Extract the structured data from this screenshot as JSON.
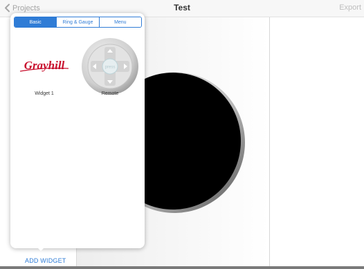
{
  "navbar": {
    "back_label": "Projects",
    "title": "Test",
    "export_label": "Export"
  },
  "popover": {
    "tabs": [
      {
        "label": "Basic",
        "active": true
      },
      {
        "label": "Ring & Gauge",
        "active": false
      },
      {
        "label": "Menu",
        "active": false
      }
    ],
    "widgets": [
      {
        "label": "Widget 1",
        "logo_text": "Grayhill",
        "icon": "grayhill-logo-icon"
      },
      {
        "label": "Remote",
        "center_text": "press",
        "icon": "remote-dpad-icon"
      }
    ]
  },
  "bottom": {
    "add_widget_label": "ADD WIDGET"
  },
  "colors": {
    "accent": "#2f7cd6",
    "logo_red": "#c8102e",
    "knob_face": "#000000"
  }
}
